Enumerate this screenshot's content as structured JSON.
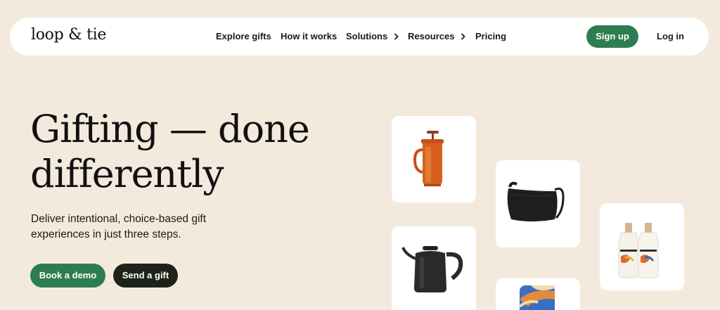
{
  "brand": {
    "logo_text": "loop & tie"
  },
  "nav": {
    "items": [
      {
        "label": "Explore gifts",
        "has_chevron": false
      },
      {
        "label": "How it works",
        "has_chevron": false
      },
      {
        "label": "Solutions",
        "has_chevron": true
      },
      {
        "label": "Resources",
        "has_chevron": true
      },
      {
        "label": "Pricing",
        "has_chevron": false
      }
    ],
    "signup_label": "Sign up",
    "login_label": "Log in"
  },
  "hero": {
    "title_line1": "Gifting — done",
    "title_line2": "differently",
    "subtitle": "Deliver intentional, choice-based gift experiences in just three steps.",
    "primary_button": "Book a demo",
    "secondary_button": "Send a gift"
  },
  "products": [
    {
      "name": "french-press-icon"
    },
    {
      "name": "shoulder-bag-icon"
    },
    {
      "name": "olive-oil-bottles-icon"
    },
    {
      "name": "kettle-icon"
    },
    {
      "name": "colorful-box-icon"
    }
  ],
  "colors": {
    "background": "#f3eadd",
    "accent_green": "#2e7d50",
    "dark_button": "#1d2318",
    "text": "#111111"
  }
}
